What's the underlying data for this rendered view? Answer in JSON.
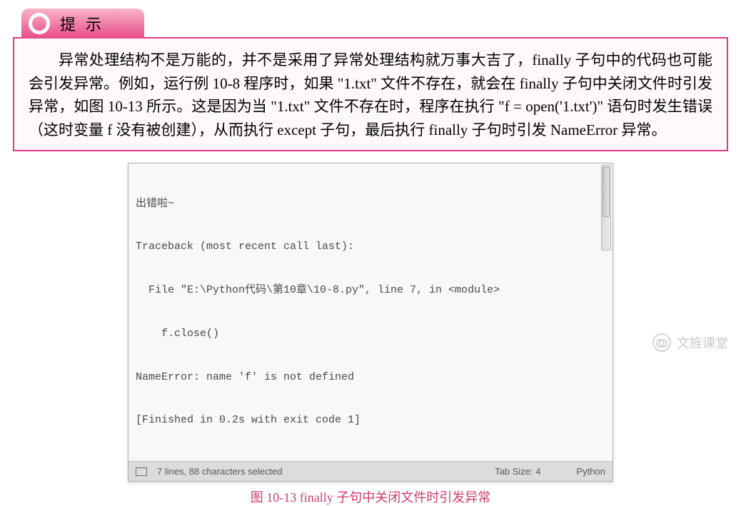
{
  "callout": {
    "tab_label": "提示",
    "body": "异常处理结构不是万能的，并不是采用了异常处理结构就万事大吉了，finally 子句中的代码也可能会引发异常。例如，运行例 10-8 程序时，如果 \"1.txt\" 文件不存在，就会在 finally 子句中关闭文件时引发异常，如图 10-13 所示。这是因为当 \"1.txt\" 文件不存在时，程序在执行 \"f = open('1.txt')\" 语句时发生错误（这时变量 f 没有被创建），从而执行 except 子句，最后执行 finally 子句时引发 NameError 异常。"
  },
  "code": {
    "lines": {
      "l1": "出错啦~",
      "l2": "Traceback (most recent call last):",
      "l3": "File \"E:\\Python代码\\第10章\\10-8.py\", line 7, in <module>",
      "l4": "f.close()",
      "l5": "NameError: name 'f' is not defined",
      "l6": "[Finished in 0.2s with exit code 1]"
    },
    "statusbar": {
      "selection": "7 lines, 88 characters selected",
      "tabsize": "Tab Size: 4",
      "syntax": "Python"
    }
  },
  "caption": "图 10-13   finally 子句中关闭文件时引发异常",
  "watermark": "文旌课堂"
}
